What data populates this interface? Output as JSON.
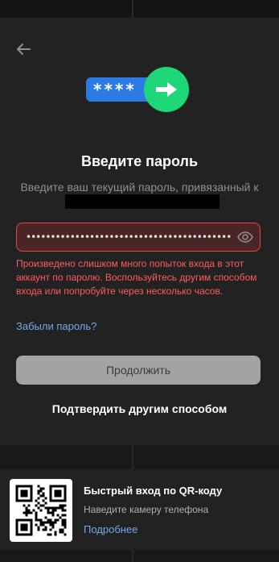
{
  "hero": {
    "pill_text": "****"
  },
  "login": {
    "title": "Введите пароль",
    "subtitle": "Введите ваш текущий пароль, привязанный к",
    "password_value": "••••••••••••••••••••••••••••••••••••••••••",
    "error_text": "Произведено слишком много попыток входа в этот аккаунт по паролю. Воспользуйтесь другим способом входа или попробуйте через несколько часов.",
    "forgot_label": "Забыли пароль?",
    "continue_label": "Продолжить",
    "other_way_label": "Подтвердить другим способом"
  },
  "qr": {
    "title": "Быстрый вход по QR-коду",
    "subtitle": "Наведите камеру телефона",
    "more_label": "Подробнее"
  },
  "icons": {
    "back": "arrow-left-icon",
    "arrow": "arrow-right-icon",
    "eye": "eye-icon"
  },
  "colors": {
    "background": "#222222",
    "accent_blue": "#2a7be4",
    "accent_green": "#1ed778",
    "error": "#ff5c5c",
    "link": "#71aaeb"
  }
}
